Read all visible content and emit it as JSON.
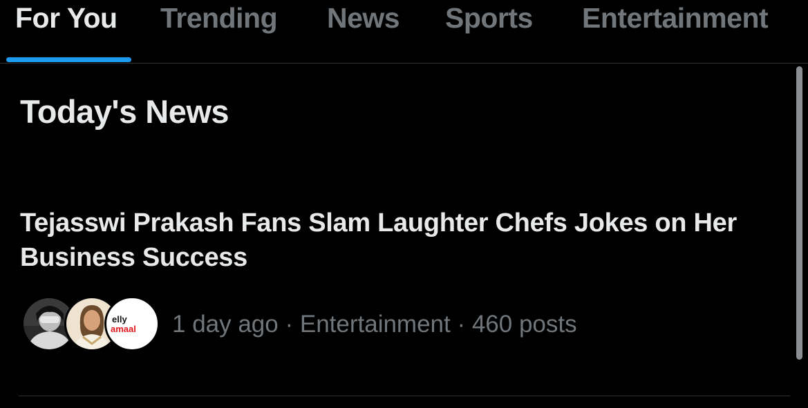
{
  "tabs": [
    {
      "label": "For You",
      "active": true
    },
    {
      "label": "Trending",
      "active": false
    },
    {
      "label": "News",
      "active": false
    },
    {
      "label": "Sports",
      "active": false
    },
    {
      "label": "Entertainment",
      "active": false
    }
  ],
  "section": {
    "title": "Today's News"
  },
  "story": {
    "headline": "Tejasswi Prakash Fans Slam Laughter Chefs Jokes on Her Business Success",
    "time": "1 day ago",
    "category": "Entertainment",
    "posts": "460 posts",
    "meta_text": "1 day ago · Entertainment · 460 posts",
    "avatar_logo_text": [
      "elly",
      "amaal"
    ]
  },
  "colors": {
    "background": "#000000",
    "text_primary": "#e7e9ea",
    "text_secondary": "#71767b",
    "accent": "#1d9bf0",
    "divider": "#2f3336"
  }
}
